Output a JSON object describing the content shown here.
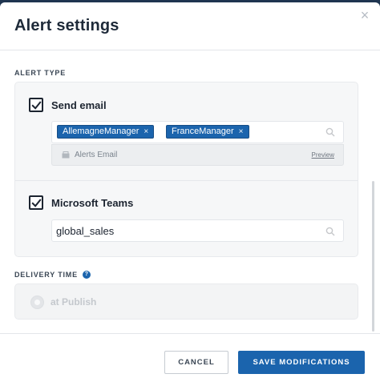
{
  "dialog": {
    "title": "Alert settings",
    "close_label": "×"
  },
  "alert_type": {
    "section_label": "ALERT TYPE",
    "email": {
      "label": "Send email",
      "checked": true,
      "recipients": [
        "AllemagneManager",
        "FranceManager"
      ],
      "remove_label": "×",
      "template_label": "Alerts Email",
      "preview_label": "Preview"
    },
    "teams": {
      "label": "Microsoft Teams",
      "checked": true,
      "channel_value": "global_sales"
    }
  },
  "delivery": {
    "section_label": "DELIVERY TIME",
    "help_label": "?",
    "option_label": "at Publish"
  },
  "footer": {
    "cancel_label": "CANCEL",
    "save_label": "SAVE MODIFICATIONS"
  },
  "colors": {
    "accent": "#1b64ad",
    "backdrop": "#1f3550"
  }
}
